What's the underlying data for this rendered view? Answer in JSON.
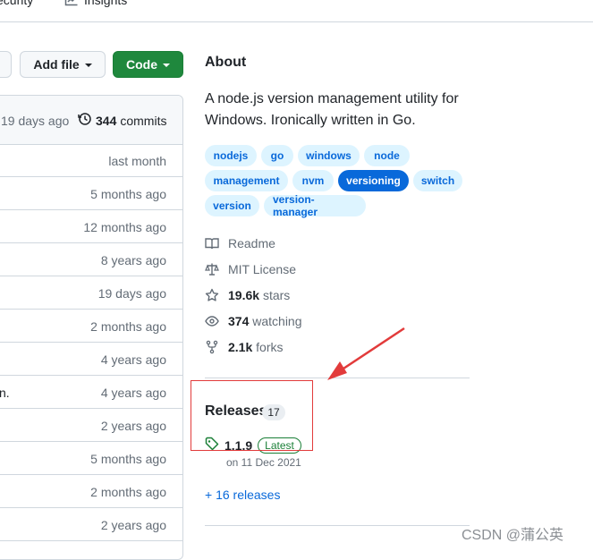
{
  "nav": {
    "security_label": "ecurity",
    "insights_label": "Insights"
  },
  "toolbar": {
    "add_file_label": "Add file",
    "code_label": "Code"
  },
  "commits": {
    "ago": "19 days ago",
    "count": "344",
    "count_label": "commits"
  },
  "files": [
    {
      "left": "",
      "ago": "last month"
    },
    {
      "left": "",
      "ago": "5 months ago"
    },
    {
      "left": "",
      "ago": "12 months ago"
    },
    {
      "left": "",
      "ago": "8 years ago"
    },
    {
      "left": "",
      "ago": "19 days ago"
    },
    {
      "left": "",
      "ago": "2 months ago"
    },
    {
      "left": "",
      "ago": "4 years ago"
    },
    {
      "left": "n.",
      "ago": "4 years ago"
    },
    {
      "left": "",
      "ago": "2 years ago"
    },
    {
      "left": "",
      "ago": "5 months ago"
    },
    {
      "left": "",
      "ago": "2 months ago"
    },
    {
      "left": "",
      "ago": "2 years ago"
    }
  ],
  "about": {
    "title": "About",
    "description": "A node.js version management utility for Windows. Ironically written in Go.",
    "topics": [
      "nodejs",
      "go",
      "windows",
      "node",
      "management",
      "nvm",
      "versioning",
      "switch",
      "version",
      "version-manager"
    ],
    "active_topic": "versioning"
  },
  "meta": {
    "readme": "Readme",
    "license": "MIT License",
    "stars_count": "19.6k",
    "stars_label": "stars",
    "watching_count": "374",
    "watching_label": "watching",
    "forks_count": "2.1k",
    "forks_label": "forks"
  },
  "releases": {
    "title": "Releases",
    "count": "17",
    "latest_version": "1.1.9",
    "latest_badge": "Latest",
    "latest_date": "on 11 Dec 2021",
    "more_link": "+ 16 releases"
  },
  "watermark": "CSDN @蒲公英",
  "colors": {
    "accent": "#0969da",
    "code_button": "#1f883d",
    "annotation": "#e23b3b"
  }
}
